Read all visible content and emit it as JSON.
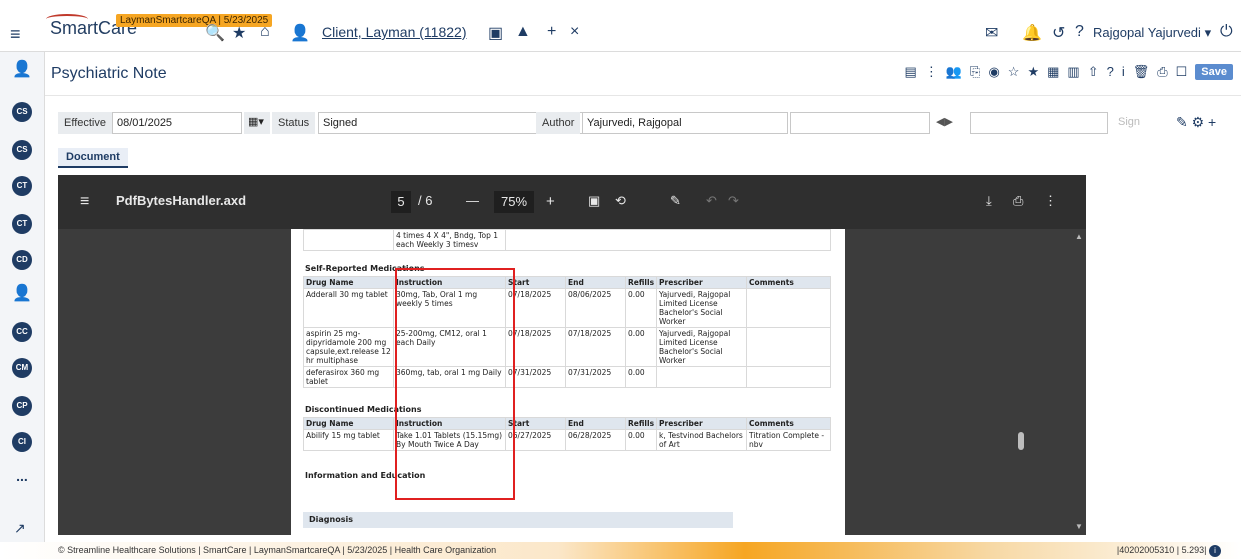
{
  "topbar": {
    "menu_icon": "hamburger-icon",
    "logo_text": "SmartCare",
    "env_tag": "LaymanSmartcareQA | 5/23/2025",
    "client_label": "Client, Layman (11822)",
    "user_name": "Rajgopal Yajurvedi",
    "user_dropdown": "▾"
  },
  "header": {
    "title": "Psychiatric Note",
    "save_label": "Save"
  },
  "filters": {
    "effective_label": "Effective",
    "effective_value": "08/01/2025",
    "status_label": "Status",
    "status_value": "Signed",
    "author_label": "Author",
    "author_value": "Yajurvedi, Rajgopal",
    "sign_label": "Sign"
  },
  "tabs": {
    "document": "Document"
  },
  "viewer": {
    "filename": "PdfBytesHandler.axd",
    "page_current": "5",
    "page_total": "/ 6",
    "zoom": "75%",
    "minus": "—",
    "plus": "+"
  },
  "pdf": {
    "top_fragment": "4 times 4 X 4\", Bndg, Top 1 each Weekly 3 timesv",
    "self_reported_title": "Self-Reported Medications",
    "discontinued_title": "Discontinued Medications",
    "info_title": "Information and Education",
    "diagnosis_title": "Diagnosis",
    "columns": [
      "Drug Name",
      "Instruction",
      "Start",
      "End",
      "Refills",
      "Prescriber",
      "Comments"
    ],
    "self_reported_rows": [
      [
        "Adderall 30 mg tablet",
        "30mg, Tab, Oral 1 mg weekly 5 times",
        "07/18/2025",
        "08/06/2025",
        "0.00",
        "Yajurvedi, Rajgopal Limited License Bachelor's Social Worker",
        ""
      ],
      [
        "aspirin 25 mg-dipyridamole 200 mg capsule,ext.release 12 hr multiphase",
        "25-200mg, CM12, oral 1 each Daily",
        "07/18/2025",
        "07/18/2025",
        "0.00",
        "Yajurvedi, Rajgopal Limited License Bachelor's Social Worker",
        ""
      ],
      [
        "deferasirox 360 mg tablet",
        "360mg, tab, oral 1 mg Daily",
        "07/31/2025",
        "07/31/2025",
        "0.00",
        "",
        ""
      ]
    ],
    "discontinued_rows": [
      [
        "Abilify 15 mg tablet",
        "Take 1.01 Tablets (15.15mg) By Mouth Twice A Day",
        "06/27/2025",
        "06/28/2025",
        "0.00",
        "k, Testvinod Bachelors of Art",
        "Titration Complete - nbv"
      ]
    ]
  },
  "leftbar": [
    "CS",
    "CS",
    "CT",
    "CT",
    "CD",
    "person",
    "CC",
    "CM",
    "CP",
    "CI",
    "..."
  ],
  "footer": {
    "left": "© Streamline Healthcare Solutions | SmartCare | LaymanSmartcareQA | 5/23/2025 | Health Care Organization",
    "right": "|40202005310 | 5.293|"
  },
  "colors": {
    "brand": "#1f3c64",
    "accent": "#f6a623",
    "highlight": "#e02020"
  }
}
